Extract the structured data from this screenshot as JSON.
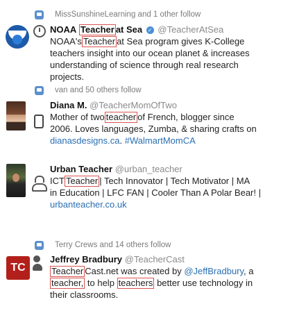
{
  "items": [
    {
      "context": "MissSunshineLearning and 1 other follow",
      "name": "NOAA",
      "name_highlight": "Teacher",
      "name_rest": "at Sea",
      "handle": "@TeacherAtSea",
      "bio_1a": "NOAA's",
      "bio_1b": "Teacher",
      "bio_1c": "at Sea program gives K-College",
      "bio_2": "teachers insight into our ocean planet & increases",
      "bio_3": "understanding of science through real research",
      "bio_4": "projects."
    },
    {
      "context": "van and 50 others follow",
      "name": "Diana M.",
      "handle": "@TeacherMomOfTwo",
      "bio_1a": "Mother of two",
      "bio_1b": "teacher",
      "bio_1c": "of French, blogger since",
      "bio_2": "2006. Loves languages, Zumba, & sharing crafts on",
      "bio_3a": "dianasdesigns.ca",
      "bio_3b": ".",
      "bio_3c": "#WalmartMomCA"
    },
    {
      "name": "Urban Teacher",
      "handle": "@urban_teacher",
      "bio_1a": "ICT",
      "bio_1b": "Teacher",
      "bio_1c": "| Tech Innovator | Tech Motivator | MA",
      "bio_2": "in Education | LFC FAN | Cooler Than A Polar Bear! |",
      "bio_3": "urbanteacher.co.uk"
    },
    {
      "context": "Terry Crews and 14 others follow",
      "name": "Jeffrey Bradbury",
      "handle": "@TeacherCast",
      "bio_1a": "Teacher",
      "bio_1b": "Cast.net was created by",
      "bio_1c": "@JeffBradbury",
      "bio_1d": ", a",
      "bio_2a": "teacher,",
      "bio_2b": "to help",
      "bio_2c": "teachers",
      "bio_2d": "better use technology in",
      "bio_3": "their classrooms.",
      "avatar_text": "TC"
    }
  ],
  "icons": [
    "clock-icon",
    "phone-icon",
    "person-icon",
    "group-icon",
    "follow-context-icon"
  ]
}
